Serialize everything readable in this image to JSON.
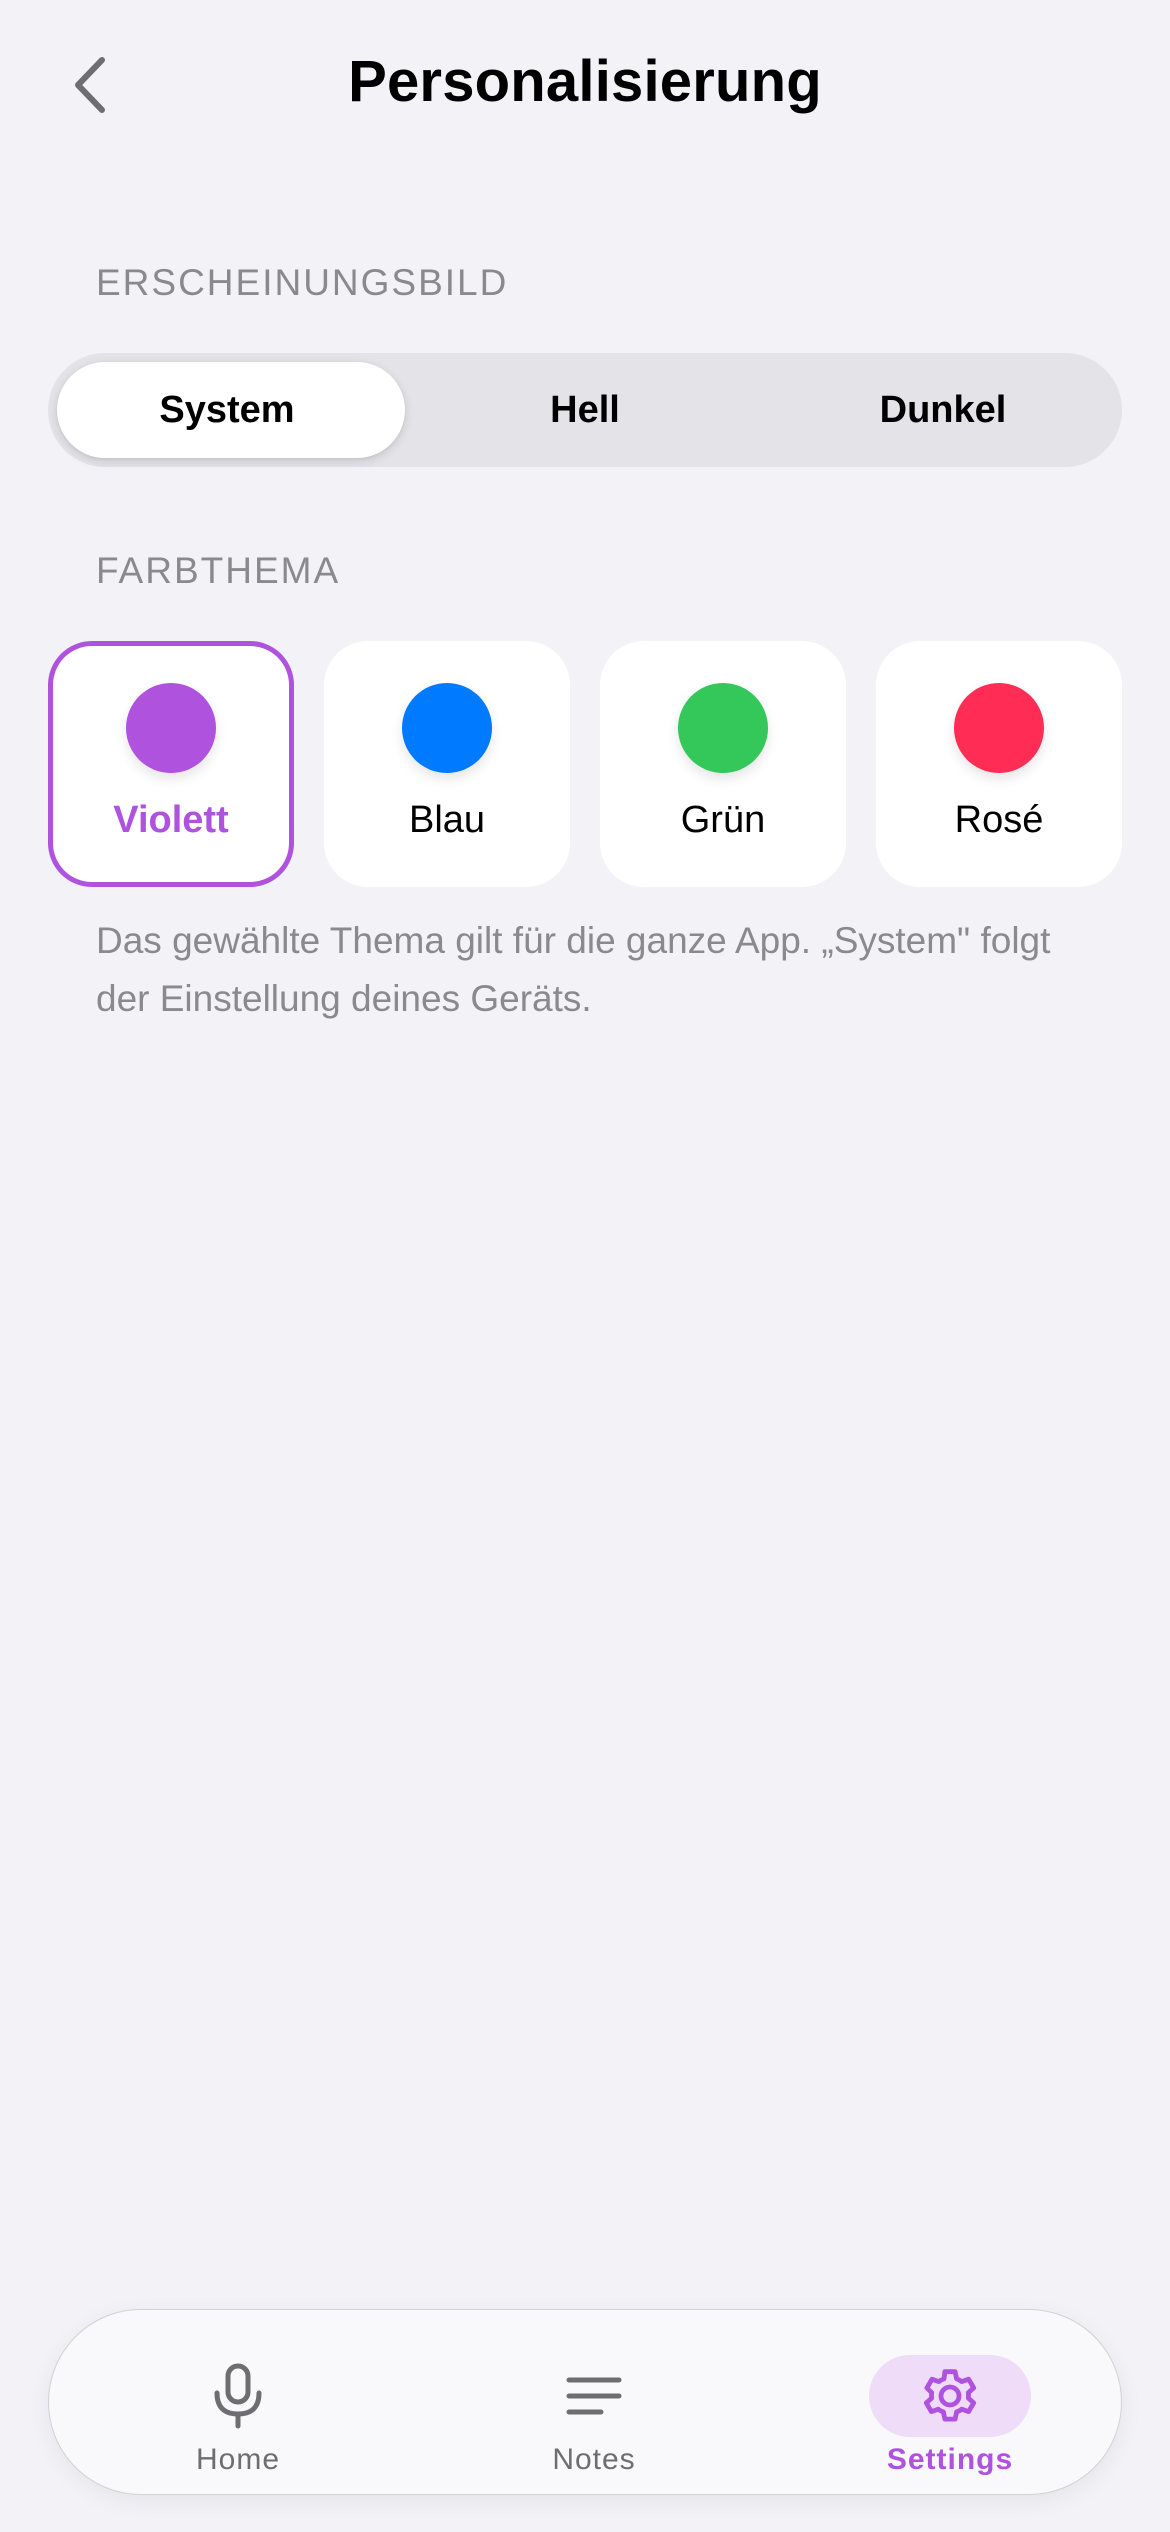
{
  "header": {
    "title": "Personalisierung",
    "back_icon": "chevron-left-icon"
  },
  "appearance": {
    "section_label": "ERSCHEINUNGSBILD",
    "options": [
      "System",
      "Hell",
      "Dunkel"
    ],
    "selected": "System"
  },
  "color_theme": {
    "section_label": "FARBTHEMA",
    "options": [
      {
        "label": "Violett",
        "color": "#af52de"
      },
      {
        "label": "Blau",
        "color": "#007aff"
      },
      {
        "label": "Grün",
        "color": "#34c759"
      },
      {
        "label": "Rosé",
        "color": "#ff2d55"
      }
    ],
    "selected": "Violett",
    "footnote": "Das gewählte Thema gilt für die ganze App. „System\" folgt der Einstellung deines Geräts."
  },
  "tabbar": {
    "tabs": [
      {
        "label": "Home",
        "icon": "microphone-icon"
      },
      {
        "label": "Notes",
        "icon": "lines-icon"
      },
      {
        "label": "Settings",
        "icon": "gear-icon"
      }
    ],
    "active": "Settings"
  },
  "colors": {
    "accent": "#af52de",
    "background": "#f2f2f7",
    "secondary_text": "#8a8a8e"
  }
}
